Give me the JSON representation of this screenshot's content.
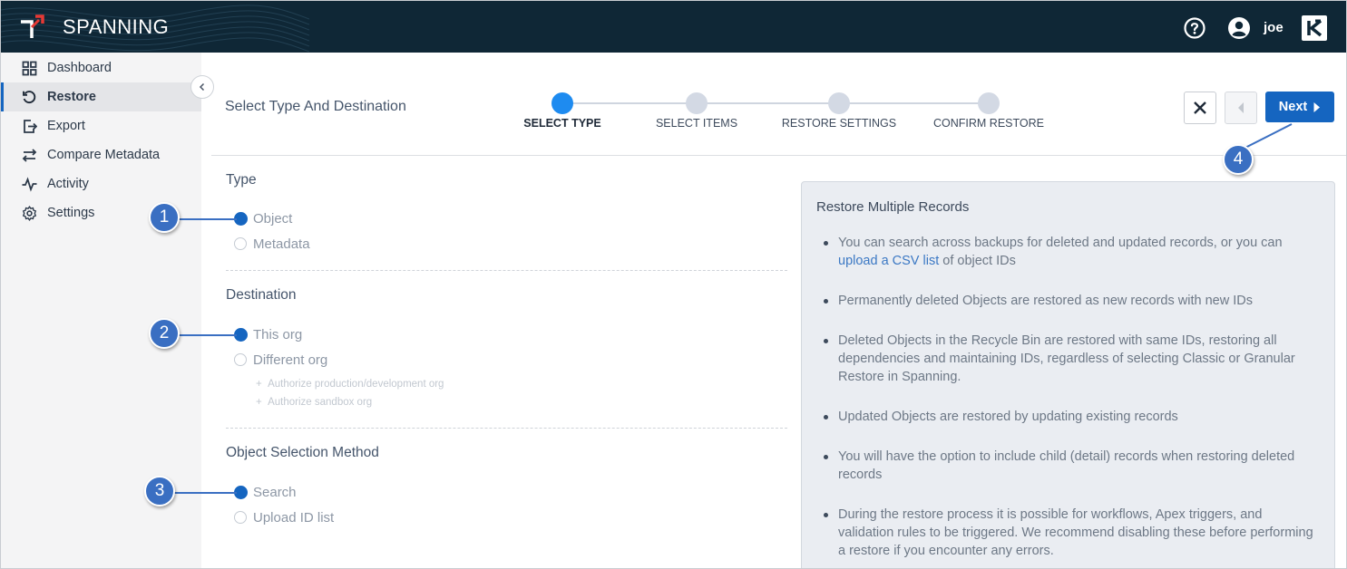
{
  "app": {
    "brand": "SPANNING",
    "username": "joe"
  },
  "colors": {
    "topbar": "#0f2736",
    "primary": "#1565c0",
    "step_active": "#1e8bf0",
    "callout": "#3a6fc2"
  },
  "sidebar": {
    "items": [
      {
        "label": "Dashboard",
        "icon": "grid-icon",
        "active": false
      },
      {
        "label": "Restore",
        "icon": "restore-icon",
        "active": true
      },
      {
        "label": "Export",
        "icon": "export-icon",
        "active": false
      },
      {
        "label": "Compare Metadata",
        "icon": "compare-arrows-icon",
        "active": false
      },
      {
        "label": "Activity",
        "icon": "activity-icon",
        "active": false
      },
      {
        "label": "Settings",
        "icon": "gear-icon",
        "active": false
      }
    ]
  },
  "header": {
    "title": "Select Type And Destination",
    "steps": [
      {
        "label": "SELECT TYPE",
        "active": true
      },
      {
        "label": "SELECT ITEMS",
        "active": false
      },
      {
        "label": "RESTORE SETTINGS",
        "active": false
      },
      {
        "label": "CONFIRM RESTORE",
        "active": false
      }
    ],
    "next_label": "Next"
  },
  "form": {
    "type": {
      "title": "Type",
      "options": [
        "Object",
        "Metadata"
      ],
      "selected": "Object"
    },
    "destination": {
      "title": "Destination",
      "options": [
        "This org",
        "Different org"
      ],
      "selected": "This org",
      "links": [
        "Authorize production/development org",
        "Authorize sandbox org"
      ]
    },
    "method": {
      "title": "Object Selection Method",
      "options": [
        "Search",
        "Upload ID list"
      ],
      "selected": "Search"
    }
  },
  "info": {
    "title": "Restore Multiple Records",
    "bullet1_pre": "You can search across backups for deleted and updated records, or you can",
    "bullet1_link": "upload a CSV list",
    "bullet1_post": "of object IDs",
    "bullets": [
      "Permanently deleted Objects are restored as new records with new IDs",
      "Deleted Objects in the Recycle Bin are restored with same IDs, restoring all dependencies and maintaining IDs, regardless of selecting Classic or Granular Restore in Spanning.",
      "Updated Objects are restored by updating existing records",
      "You will have the option to include child (detail) records when restoring deleted records",
      "During the restore process it is possible for workflows, Apex triggers, and validation rules to be triggered. We recommend disabling these before performing a restore if you encounter any errors."
    ]
  },
  "callouts": [
    "1",
    "2",
    "3",
    "4"
  ]
}
